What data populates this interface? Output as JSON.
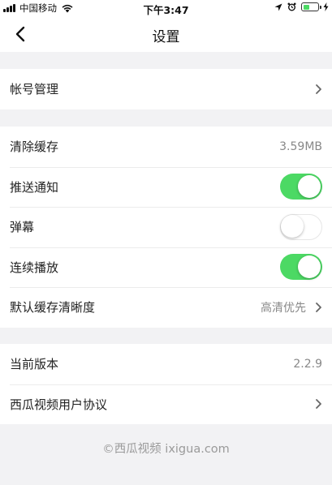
{
  "status_bar": {
    "carrier": "中国移动",
    "time": "下午3:47"
  },
  "nav": {
    "title": "设置"
  },
  "groups": [
    {
      "rows": [
        {
          "label": "帐号管理"
        }
      ]
    },
    {
      "rows": [
        {
          "label": "清除缓存",
          "value": "3.59MB"
        },
        {
          "label": "推送通知",
          "toggle": true
        },
        {
          "label": "弹幕",
          "toggle": false
        },
        {
          "label": "连续播放",
          "toggle": true
        },
        {
          "label": "默认缓存清晰度",
          "value": "高清优先"
        }
      ]
    },
    {
      "rows": [
        {
          "label": "当前版本",
          "value": "2.2.9"
        },
        {
          "label": "西瓜视频用户协议"
        }
      ]
    }
  ],
  "footer": "©西瓜视频 ixigua.com",
  "colors": {
    "toggle_on": "#4cd964",
    "background": "#f2f2f4"
  }
}
